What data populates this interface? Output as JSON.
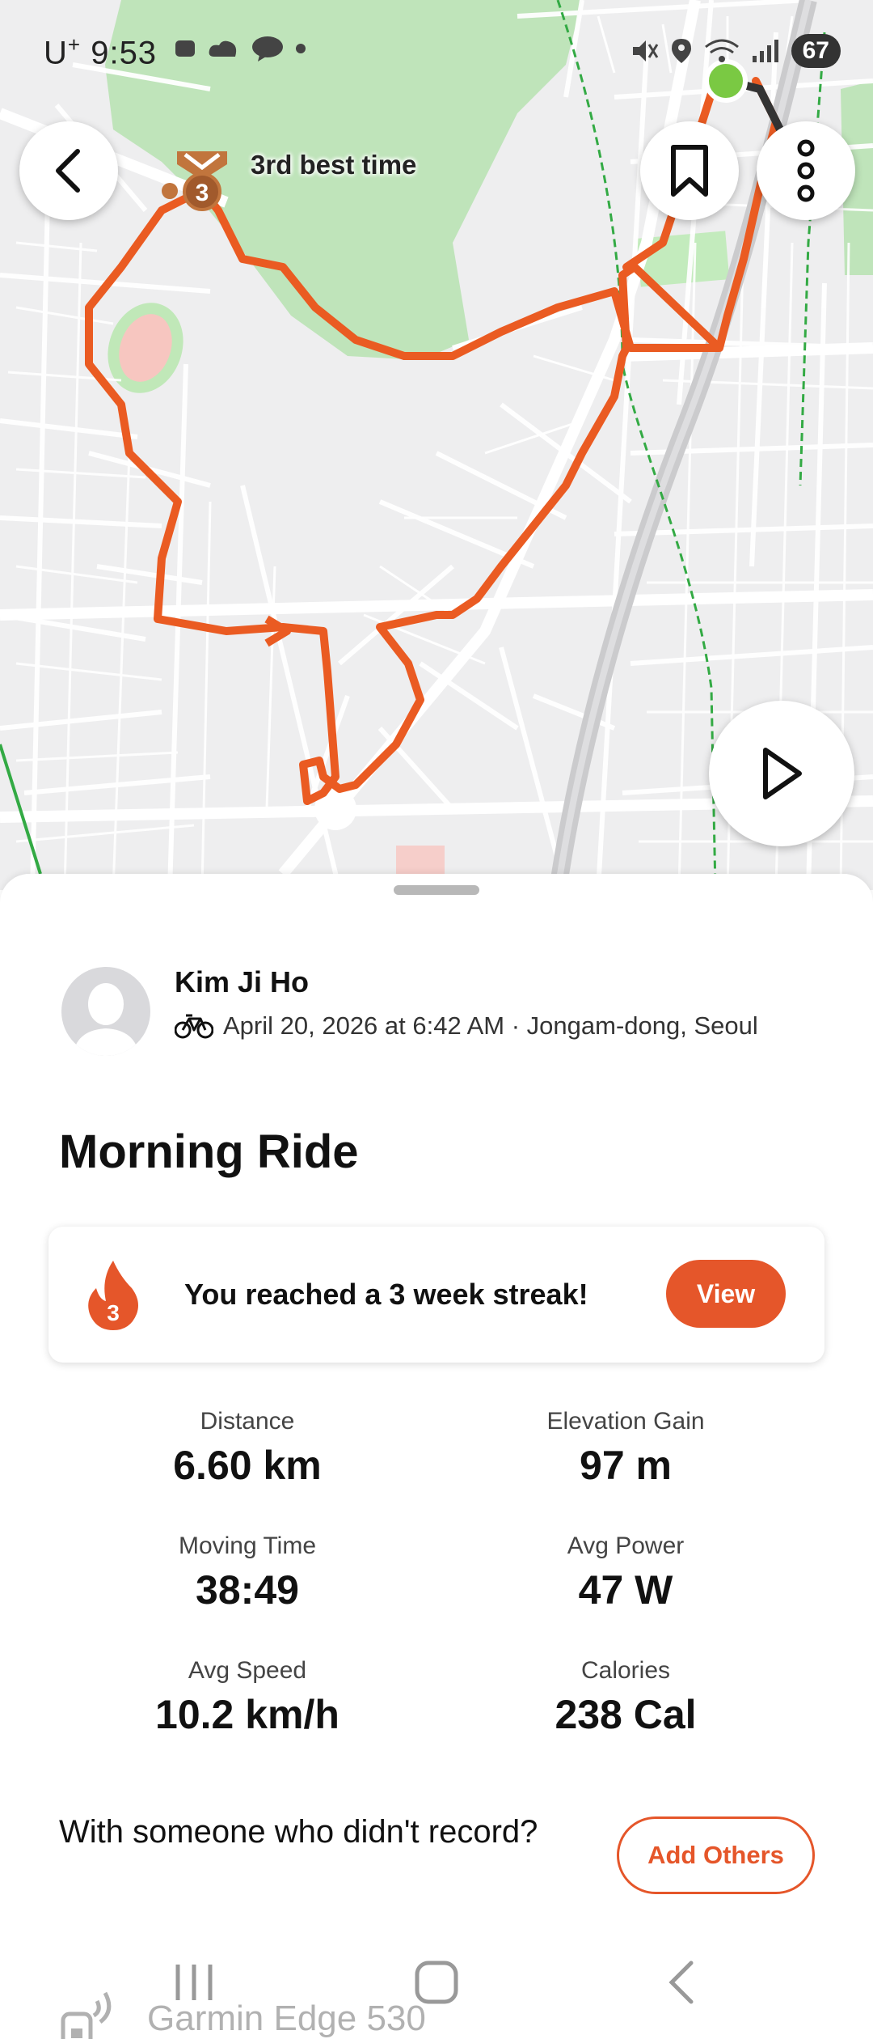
{
  "status_bar": {
    "carrier": "U",
    "carrier_sup": "+",
    "time": "9:53",
    "battery": "67"
  },
  "map": {
    "segment_label": "3rd best time",
    "medal_rank": "3"
  },
  "activity": {
    "athlete_name": "Kim Ji Ho",
    "meta": "April 20, 2026 at 6:42 AM · Jongam-dong, Seoul",
    "title": "Morning Ride"
  },
  "streak": {
    "count": "3",
    "text": "You reached a 3 week streak!",
    "button": "View"
  },
  "stats": [
    {
      "label": "Distance",
      "value": "6.60 km"
    },
    {
      "label": "Elevation Gain",
      "value": "97 m"
    },
    {
      "label": "Moving Time",
      "value": "38:49"
    },
    {
      "label": "Avg Power",
      "value": "47 W"
    },
    {
      "label": "Avg Speed",
      "value": "10.2 km/h"
    },
    {
      "label": "Calories",
      "value": "238 Cal"
    }
  ],
  "others": {
    "text": "With someone who didn't record?",
    "button": "Add Others"
  },
  "device": {
    "name": "Garmin Edge 530"
  },
  "colors": {
    "accent": "#e5562a",
    "route": "#ea5b22",
    "park": "#b6e2b0",
    "start_marker": "#7ac943"
  }
}
